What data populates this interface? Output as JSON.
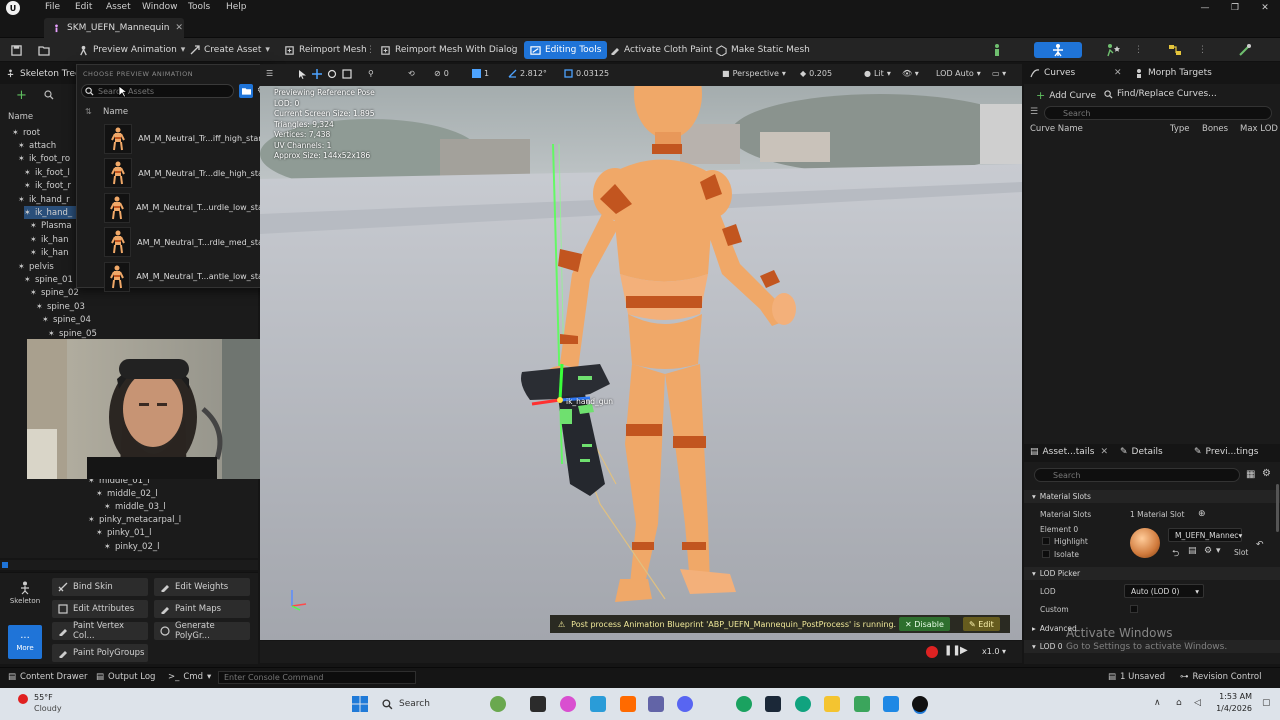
{
  "menubar": {
    "logo": "U",
    "items": [
      "File",
      "Edit",
      "Asset",
      "Window",
      "Tools",
      "Help"
    ],
    "win_min": "—",
    "win_max": "❐",
    "win_close": "✕"
  },
  "tab": {
    "title": "SKM_UEFN_Mannequin",
    "close": "✕"
  },
  "toolbar": {
    "preview_animation": "Preview Animation",
    "create_asset": "Create Asset",
    "reimport_mesh": "Reimport Mesh",
    "reimport_mesh_dialog": "Reimport Mesh With Dialog",
    "editing_tools": "Editing Tools",
    "activate_cloth_paint": "Activate Cloth Paint",
    "make_static_mesh": "Make Static Mesh"
  },
  "skeleton": {
    "tab_label": "Skeleton Tree",
    "name_header": "Name",
    "bones_top": [
      {
        "label": "root",
        "indent": 0,
        "selected": false
      },
      {
        "label": "attach",
        "indent": 1,
        "selected": false
      },
      {
        "label": "ik_foot_ro",
        "indent": 1,
        "selected": false
      },
      {
        "label": "ik_foot_l",
        "indent": 2,
        "selected": false
      },
      {
        "label": "ik_foot_r",
        "indent": 2,
        "selected": false
      },
      {
        "label": "ik_hand_r",
        "indent": 1,
        "selected": false
      },
      {
        "label": "ik_hand_",
        "indent": 2,
        "selected": true
      },
      {
        "label": "Plasma",
        "indent": 3,
        "selected": false
      },
      {
        "label": "ik_han",
        "indent": 3,
        "selected": false
      },
      {
        "label": "ik_han",
        "indent": 3,
        "selected": false
      },
      {
        "label": "pelvis",
        "indent": 1,
        "selected": false
      },
      {
        "label": "spine_01",
        "indent": 2,
        "selected": false
      },
      {
        "label": "spine_02",
        "indent": 3,
        "selected": false
      },
      {
        "label": "spine_03",
        "indent": 4,
        "selected": false
      },
      {
        "label": "spine_04",
        "indent": 5,
        "selected": false
      },
      {
        "label": "spine_05",
        "indent": 6,
        "selected": false
      }
    ],
    "bones_bottom": [
      {
        "label": "middle_01_l",
        "indent": 7
      },
      {
        "label": "middle_02_l",
        "indent": 8
      },
      {
        "label": "middle_03_l",
        "indent": 9
      },
      {
        "label": "pinky_metacarpal_l",
        "indent": 7
      },
      {
        "label": "pinky_01_l",
        "indent": 8
      },
      {
        "label": "pinky_02_l",
        "indent": 9
      }
    ]
  },
  "preview_dropdown": {
    "header": "CHOOSE PREVIEW ANIMATION",
    "search_placeholder": "Search Assets",
    "column_name": "Name",
    "assets": [
      "AM_M_Neutral_Tr...iff_high_standF",
      "AM_M_Neutral_Tr...dle_high_stand",
      "AM_M_Neutral_T...urdle_low_stand",
      "AM_M_Neutral_T...rdle_med_stand",
      "AM_M_Neutral_T...antle_low_stand"
    ]
  },
  "tools": {
    "skeleton_label": "Skeleton",
    "more_label": "More",
    "buttons": [
      "Bind Skin",
      "Edit Weights",
      "Edit Attributes",
      "Paint Maps",
      "Paint Vertex Col...",
      "Generate PolyGr...",
      "Paint PolyGroups"
    ]
  },
  "viewport": {
    "perspective": "Perspective",
    "lit": "Lit",
    "lod": "LOD Auto",
    "angle": "1",
    "zoom_val": "2.812°",
    "scale_val": "0.03125",
    "speed": "0.205",
    "stats": [
      "Previewing Reference Pose",
      "LOD: 0",
      "Current Screen Size: 1.895",
      "Triangles: 9,324",
      "Vertices: 7,438",
      "UV Channels: 1",
      "Approx Size: 144x52x186"
    ],
    "bone_label": "ik_hand_gun",
    "notice": "Post process Animation Blueprint 'ABP_UEFN_Mannequin_PostProcess' is running.",
    "disable_label": "Disable",
    "edit_label": "Edit",
    "play_speed": "x1.0"
  },
  "curves": {
    "tab_curves": "Curves",
    "tab_morph": "Morph Targets",
    "add_curve": "Add Curve",
    "find_replace": "Find/Replace Curves...",
    "search_placeholder": "Search",
    "columns": [
      "Curve Name",
      "Type",
      "Bones",
      "Max LOD"
    ]
  },
  "details": {
    "tab_asset": "Asset...tails",
    "tab_details": "Details",
    "tab_preview": "Previ...tings",
    "search_placeholder": "Search",
    "material_slots_section": "Material Slots",
    "material_slots_label": "Material Slots",
    "material_slots_value": "1 Material Slot",
    "element": "Element 0",
    "highlight": "Highlight",
    "isolate": "Isolate",
    "material_name": "M_UEFN_Mannec",
    "slot_label": "Slot",
    "lod_picker": "LOD Picker",
    "lod_label": "LOD",
    "lod_value": "Auto (LOD 0)",
    "custom_label": "Custom",
    "advanced": "Advanced",
    "lod0": "LOD 0"
  },
  "watermark": {
    "line1": "Activate Windows",
    "line2": "Go to Settings to activate Windows."
  },
  "statusbar": {
    "content_drawer": "Content Drawer",
    "output_log": "Output Log",
    "cmd": "Cmd",
    "console_placeholder": "Enter Console Command",
    "unsaved": "1 Unsaved",
    "revision_control": "Revision Control"
  },
  "taskbar": {
    "weather_temp": "55°F",
    "weather_desc": "Cloudy",
    "search_label": "Search",
    "time": "1:53 AM",
    "date": "1/4/2026"
  },
  "colors": {
    "accent": "#1f74d8",
    "mannequin": "#f0a868",
    "mannequin_dark": "#c2551f"
  }
}
